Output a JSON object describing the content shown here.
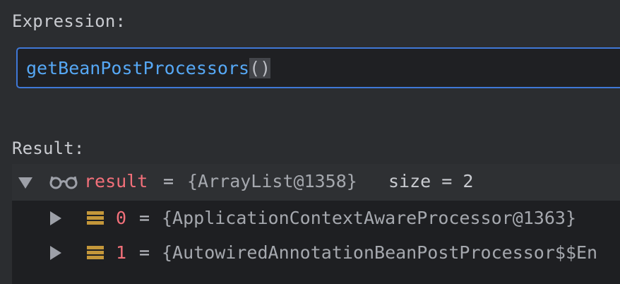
{
  "expression": {
    "label": "Expression:",
    "method": "getBeanPostProcessors",
    "parens": "()"
  },
  "result": {
    "label": "Result:",
    "root": {
      "name": "result",
      "eq": "=",
      "value": "{ArrayList@1358}",
      "size": "size = 2"
    },
    "children": [
      {
        "index": "0",
        "eq": "=",
        "value": "{ApplicationContextAwareProcessor@1363}"
      },
      {
        "index": "1",
        "eq": "=",
        "value": "{AutowiredAnnotationBeanPostProcessor$$En"
      }
    ]
  },
  "colors": {
    "background": "#2b2d30",
    "field_border": "#3f78d6",
    "method": "#56a8f5",
    "var_name": "#f2707a",
    "stack_icon": "#c4973a"
  },
  "icons": {
    "root_toggle": "triangle-down-icon",
    "root_watch": "glasses-icon",
    "child_toggle": "triangle-right-icon",
    "child_type": "stack-icon"
  }
}
